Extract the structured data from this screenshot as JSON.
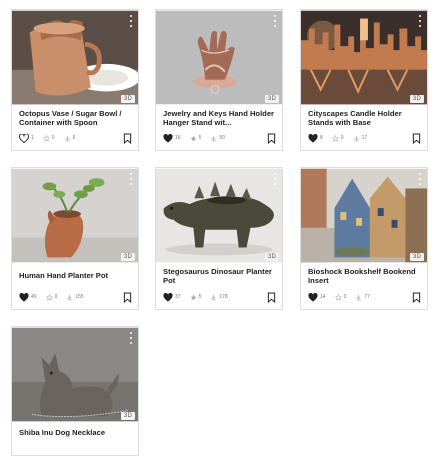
{
  "badge_3d": "3D",
  "cards": [
    {
      "title": "Octopus Vase / Sugar Bowl / Container with Spoon",
      "likes": "1",
      "liked": false,
      "makes": "0",
      "downloads": "5",
      "image": "copper-octopus-vase"
    },
    {
      "title": "Jewelry and Keys Hand Holder Hanger Stand wit...",
      "likes": "16",
      "liked": true,
      "makes": "5",
      "downloads": "50",
      "image": "hand-jewelry-stand"
    },
    {
      "title": "Cityscapes Candle Holder Stands with Base",
      "likes": "8",
      "liked": true,
      "makes": "0",
      "downloads": "17",
      "image": "city-candle-holders"
    },
    {
      "title": "Human Hand Planter Pot",
      "likes": "49",
      "liked": true,
      "makes": "0",
      "downloads": "155",
      "image": "hand-planter-succulent"
    },
    {
      "title": "Stegosaurus Dinosaur Planter Pot",
      "likes": "37",
      "liked": true,
      "makes": "5",
      "downloads": "178",
      "image": "stegosaurus-planter"
    },
    {
      "title": "Bioshock Bookshelf Bookend Insert",
      "likes": "14",
      "liked": true,
      "makes": "0",
      "downloads": "77",
      "image": "bioshock-bookend"
    },
    {
      "title": "Shiba Inu Dog Necklace",
      "image": "shiba-necklace"
    }
  ]
}
